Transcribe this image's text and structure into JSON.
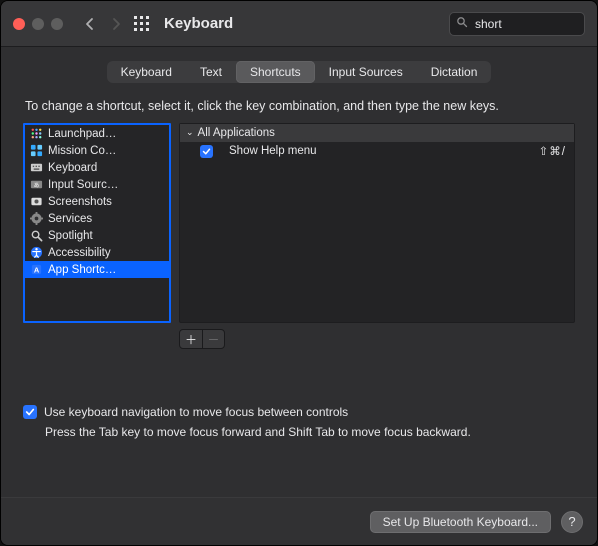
{
  "titlebar": {
    "title": "Keyboard"
  },
  "search": {
    "placeholder": "Search",
    "value": "short"
  },
  "tabs": {
    "items": [
      "Keyboard",
      "Text",
      "Shortcuts",
      "Input Sources",
      "Dictation"
    ],
    "active_index": 2
  },
  "instruction": "To change a shortcut, select it, click the key combination, and then type the new keys.",
  "categories": [
    {
      "icon": "launchpad",
      "label": "Launchpad…",
      "selected": false
    },
    {
      "icon": "mission",
      "label": "Mission Co…",
      "selected": false
    },
    {
      "icon": "keyboard",
      "label": "Keyboard",
      "selected": false
    },
    {
      "icon": "input",
      "label": "Input Sourc…",
      "selected": false
    },
    {
      "icon": "screenshot",
      "label": "Screenshots",
      "selected": false
    },
    {
      "icon": "services",
      "label": "Services",
      "selected": false
    },
    {
      "icon": "spotlight",
      "label": "Spotlight",
      "selected": false
    },
    {
      "icon": "accessibility",
      "label": "Accessibility",
      "selected": false
    },
    {
      "icon": "appshort",
      "label": "App Shortc…",
      "selected": true
    }
  ],
  "shortcuts": {
    "group_title": "All Applications",
    "rows": [
      {
        "checked": true,
        "label": "Show Help menu",
        "keys": "⇧⌘/"
      }
    ]
  },
  "buttons": {
    "add": "＋",
    "remove": "－",
    "setup": "Set Up Bluetooth Keyboard...",
    "help": "?"
  },
  "kbnav": {
    "checked": true,
    "label": "Use keyboard navigation to move focus between controls",
    "hint": "Press the Tab key to move focus forward and Shift Tab to move focus backward."
  }
}
